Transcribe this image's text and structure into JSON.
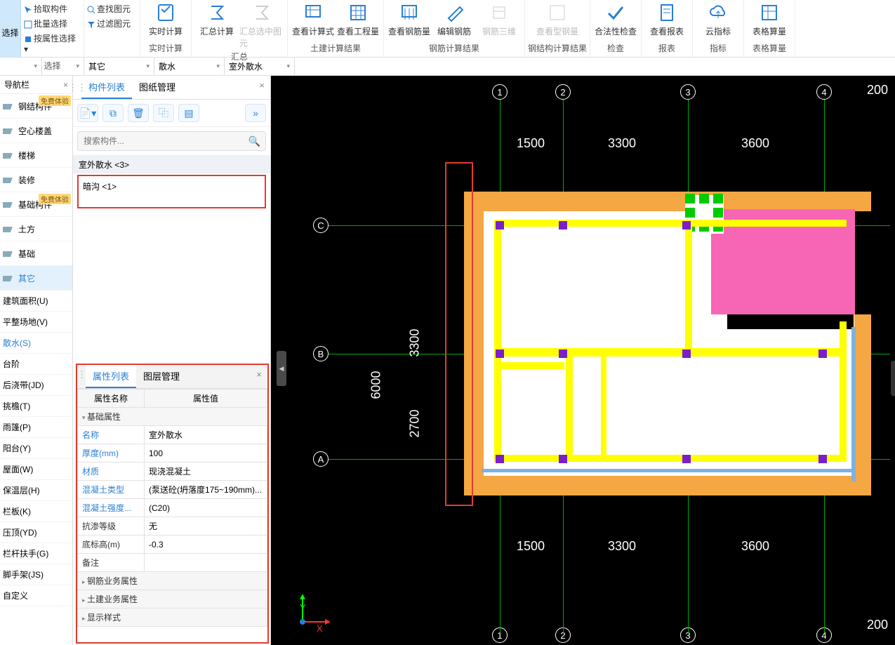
{
  "ribbon": {
    "select_label": "选择",
    "small": {
      "pick": "拾取构件",
      "batch": "批量选择",
      "byprop": "按属性选择",
      "find": "查找图元",
      "filter": "过滤图元",
      "footer": "选择"
    },
    "groups": [
      {
        "footer": "实时计算",
        "buttons": [
          {
            "id": "rt-calc",
            "label": "实时计算"
          }
        ]
      },
      {
        "footer": "汇总",
        "buttons": [
          {
            "id": "sum-calc",
            "label": "汇总计算"
          },
          {
            "id": "sum-sel",
            "label": "汇总选中图元",
            "disabled": true
          }
        ]
      },
      {
        "footer": "土建计算结果",
        "buttons": [
          {
            "id": "view-calc",
            "label": "查看计算式"
          },
          {
            "id": "view-eng",
            "label": "查看工程量"
          }
        ]
      },
      {
        "footer": "钢筋计算结果",
        "buttons": [
          {
            "id": "view-rebar",
            "label": "查看钢筋量"
          },
          {
            "id": "edit-rebar",
            "label": "编辑钢筋"
          },
          {
            "id": "rebar-3d",
            "label": "钢筋三维",
            "disabled": true
          }
        ]
      },
      {
        "footer": "钢结构计算结果",
        "buttons": [
          {
            "id": "view-steel",
            "label": "查看型钢量",
            "disabled": true
          }
        ]
      },
      {
        "footer": "检查",
        "buttons": [
          {
            "id": "valid",
            "label": "合法性检查"
          }
        ]
      },
      {
        "footer": "报表",
        "buttons": [
          {
            "id": "report",
            "label": "查看报表"
          }
        ]
      },
      {
        "footer": "指标",
        "buttons": [
          {
            "id": "cloud",
            "label": "云指标"
          }
        ]
      },
      {
        "footer": "表格算量",
        "buttons": [
          {
            "id": "sheet",
            "label": "表格算量"
          }
        ]
      }
    ]
  },
  "filters": {
    "c2": "其它",
    "c3": "散水",
    "c4": "室外散水"
  },
  "nav": {
    "title": "导航栏",
    "items": [
      {
        "id": "steel-comp",
        "label": "钢结构件",
        "badge": "免费体验"
      },
      {
        "id": "hollow",
        "label": "空心楼盖"
      },
      {
        "id": "stair",
        "label": "楼梯"
      },
      {
        "id": "decor",
        "label": "装修"
      },
      {
        "id": "found-comp",
        "label": "基础构件",
        "badge": "免费体验"
      },
      {
        "id": "earth",
        "label": "土方"
      },
      {
        "id": "found",
        "label": "基础"
      },
      {
        "id": "other",
        "label": "其它",
        "selected": true
      }
    ],
    "subs": [
      "建筑面积(U)",
      "平整场地(V)",
      "散水(S)",
      "台阶",
      "后浇带(JD)",
      "挑檐(T)",
      "雨篷(P)",
      "阳台(Y)",
      "屋面(W)",
      "保温层(H)",
      "栏板(K)",
      "压顶(YD)",
      "栏杆扶手(G)",
      "脚手架(JS)",
      "自定义"
    ],
    "sub_selected": "散水(S)"
  },
  "mid": {
    "tabs": {
      "t1": "构件列表",
      "t2": "图纸管理"
    },
    "search_placeholder": "搜索构件...",
    "header": "室外散水 <3>",
    "row": "暗沟 <1>"
  },
  "prop": {
    "tabs": {
      "t1": "属性列表",
      "t2": "图层管理"
    },
    "head_name": "属性名称",
    "head_val": "属性值",
    "groups": {
      "g1": "基础属性",
      "g2": "钢筋业务属性",
      "g3": "土建业务属性",
      "g4": "显示样式"
    },
    "rows": [
      {
        "n": "名称",
        "v": "室外散水"
      },
      {
        "n": "厚度(mm)",
        "v": "100"
      },
      {
        "n": "材质",
        "v": "现浇混凝土"
      },
      {
        "n": "混凝土类型",
        "v": "(泵送砼(坍落度175~190mm)..."
      },
      {
        "n": "混凝土强度...",
        "v": "(C20)"
      },
      {
        "n": "抗渗等级",
        "v": "无",
        "dark": true
      },
      {
        "n": "底标高(m)",
        "v": "-0.3",
        "dark": true
      },
      {
        "n": "备注",
        "v": "",
        "dark": true
      }
    ]
  },
  "plan": {
    "cols": [
      "1",
      "2",
      "3",
      "4"
    ],
    "rows": [
      "C",
      "B",
      "A"
    ],
    "dims_h": [
      "1500",
      "3300",
      "3600"
    ],
    "dims_v": [
      "3300",
      "2700"
    ],
    "dim_side": "6000",
    "corner": "200",
    "axis": {
      "y": "Y",
      "x": "X"
    }
  }
}
